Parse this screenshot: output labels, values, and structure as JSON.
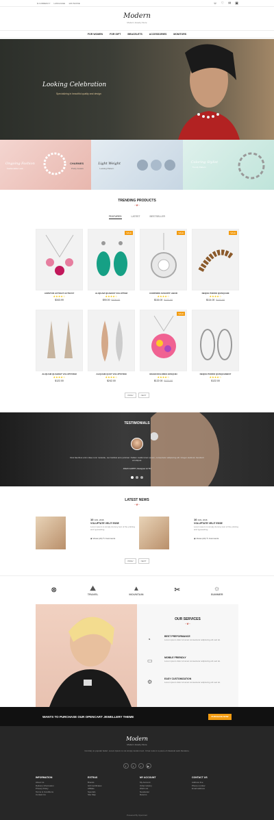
{
  "topbar": {
    "currency": "$ CURRENCY",
    "language": "LANGUAGE",
    "phone": "123 PHONE",
    "icons": [
      "user-icon",
      "heart-icon",
      "mail-icon",
      "cart-icon"
    ]
  },
  "header": {
    "logo": "Modern",
    "logo_sub": "Modern Jewelry Store"
  },
  "nav": [
    "FOR WOMEN",
    "FOR GIFT",
    "BRACELETS",
    "ACCESSORIES",
    "MONITORS"
  ],
  "hero": {
    "title": "Looking Celebration",
    "subtitle": "Specializing in beautiful quality and design"
  },
  "banners": [
    {
      "title": "Ongoing Fashion",
      "sub": "Fashionable Look"
    },
    {
      "title": "CHARMES",
      "sub": "Pretty Jewels"
    },
    {
      "title": "Light Weight",
      "sub": "Looking Pattern"
    },
    {
      "title": "Coloring Stylist",
      "sub": "Trendy Pattern"
    }
  ],
  "trending": {
    "title": "TRENDING PRODUCTS",
    "tabs": [
      "FEATURED",
      "LATEST",
      "BESTSELLER"
    ],
    "products": [
      {
        "name": "ASPETUR AUTOGIT AUTSUST",
        "price": "$343.99",
        "old": "",
        "sale": false,
        "stars": "★★★★☆"
      },
      {
        "name": "ALIQUAM QUAERAT VOLUPTEM",
        "price": "$90.00",
        "old": "$108.00",
        "sale": true,
        "stars": "★★★★☆"
      },
      {
        "name": "CORPORIS SUSCIPIT LIBOR",
        "price": "$116.00",
        "old": "$122.00",
        "sale": true,
        "stars": "★★★★☆"
      },
      {
        "name": "NEQUE PORRO QUISQUAM",
        "price": "$114.00",
        "old": "$122.00",
        "sale": true,
        "stars": "★★★★☆"
      },
      {
        "name": "ALIQUAM QUAERAT VOLUPTATEM",
        "price": "$122.00",
        "old": "",
        "sale": false,
        "stars": "★★★★☆"
      },
      {
        "name": "ALIQUAM QUAT VOLUPTATEM",
        "price": "$242.00",
        "old": "",
        "sale": false,
        "stars": "★★★★☆"
      },
      {
        "name": "MAGNI DOLORES EOSQUEI",
        "price": "$122.00",
        "old": "$122.00",
        "sale": true,
        "stars": "★★★★☆"
      },
      {
        "name": "NEQUE PORRO QUISQUAMEST",
        "price": "$122.00",
        "old": "",
        "sale": false,
        "stars": "★★★★☆"
      }
    ],
    "prev": "PREV",
    "next": "NEXT"
  },
  "testimonial": {
    "title": "TESTIMONIALS",
    "text": "Duis faucibus enim vitae nunc molestie, nec facilisis arcu pulvinar. Nullam mattis lorem ipsum, consectetur adipiscing elit. Integer eleifend, hendrerit vel aliquet.",
    "name": "JOHN GUPPY, Designer At TD"
  },
  "news": {
    "title": "LATEST NEWS",
    "items": [
      {
        "date": "10",
        "month": "JAN, 2016",
        "title": "VOLUPTATE VELIT ESSE",
        "text": "Lorem ipsum is simply dummy text of the printing and typesetting.",
        "views": "Views (24)",
        "comments": "Comments"
      },
      {
        "date": "10",
        "month": "JAN, 2016",
        "title": "VOLUPTATE VELIT ESSE",
        "text": "Lorem ipsum is simply dummy text of the printing and typesetting.",
        "views": "Views (24)",
        "comments": "Comments"
      }
    ],
    "prev": "PREV",
    "next": "NEXT"
  },
  "brands": [
    "TRAVEL",
    "MOUNTAIN",
    "SUMMER"
  ],
  "services": {
    "title": "OUR SERVICES",
    "items": [
      {
        "name": "BEST PREFORMANCE",
        "desc": "Lorem ipsum dolor sit amet consectetur adipiscing elit sed do."
      },
      {
        "name": "MOBILE FRIENDLY",
        "desc": "Lorem ipsum dolor sit amet consectetur adipiscing elit sed do."
      },
      {
        "name": "EASY CUSTOMIZATION",
        "desc": "Lorem ipsum dolor sit amet consectetur adipiscing elit sed do."
      }
    ]
  },
  "cta": {
    "text": "WANTS TO PURCHASE OUR OPENCART JEWELLERY THEME",
    "button": "PURCHASE NOW"
  },
  "footer": {
    "logo": "Modern",
    "logo_sub": "Modern Jewelry Store",
    "text": "Contrary to popular belief, Lorem Ipsum is not simply random text. It has roots in a piece of classical Latin literature.",
    "cols": [
      {
        "head": "INFORMATION",
        "links": [
          "About Us",
          "Delivery Information",
          "Privacy Policy",
          "Terms & Conditions",
          "Contact Us"
        ]
      },
      {
        "head": "EXTRAS",
        "links": [
          "Brands",
          "Gift Certificates",
          "Affiliate",
          "Specials",
          "Site Map"
        ]
      },
      {
        "head": "MY ACCOUNT",
        "links": [
          "My Account",
          "Order History",
          "Wish List",
          "Newsletter",
          "Returns"
        ]
      },
      {
        "head": "CONTACT US",
        "links": [
          "Address line",
          "Phone number",
          "Email address"
        ]
      }
    ],
    "copyright": "Powered By OpenCart"
  }
}
